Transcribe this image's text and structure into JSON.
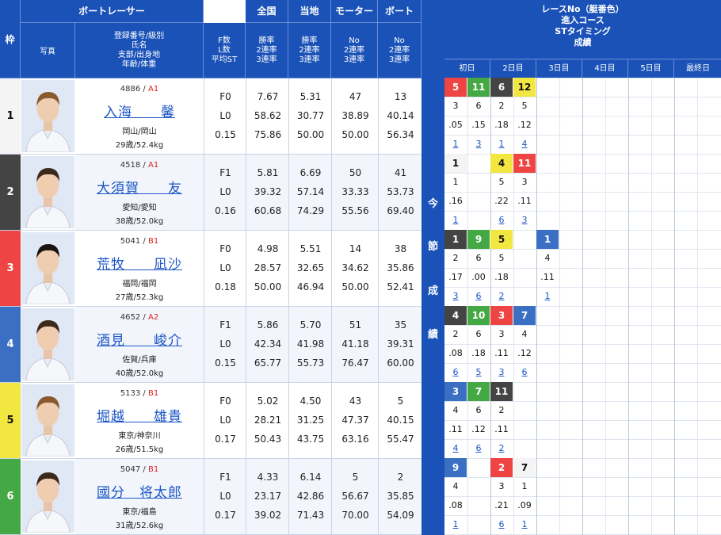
{
  "headers": {
    "waku": "枠",
    "boatracer": "ボートレーサー",
    "photo": "写真",
    "info_lines": [
      "登録番号/級別",
      "氏名",
      "支部/出身地",
      "年齢/体重"
    ],
    "f_lines": [
      "F数",
      "L数",
      "平均ST"
    ],
    "national": "全国",
    "local": "当地",
    "motor": "モーター",
    "boat": "ボート",
    "rate_lines": [
      "勝率",
      "2連率",
      "3連率"
    ],
    "no_lines": [
      "No",
      "2連率",
      "3連率"
    ]
  },
  "right_header": [
    "レースNo（艇番色）",
    "進入コース",
    "STタイミング",
    "成績"
  ],
  "days": [
    "初日",
    "2日目",
    "3日目",
    "4日目",
    "5日目",
    "最終日"
  ],
  "middle_label": [
    "今",
    "節",
    "成",
    "績"
  ],
  "colors": {
    "1": "#f4f4f4",
    "2": "#444444",
    "3": "#ee4444",
    "4": "#3a6fc4",
    "5": "#f2e640",
    "6": "#44a844"
  },
  "racers": [
    {
      "waku": "1",
      "reg": "4886",
      "cls": "A1",
      "name": "入海　　馨",
      "branch": "岡山/岡山",
      "age": "29歳/52.4kg",
      "f": "F0",
      "l": "L0",
      "st": "0.15",
      "nat": [
        "7.67",
        "58.62",
        "75.86"
      ],
      "loc": [
        "5.31",
        "30.77",
        "50.00"
      ],
      "mot": [
        "47",
        "38.89",
        "50.00"
      ],
      "boat": [
        "13",
        "40.14",
        "56.34"
      ],
      "races": [
        {
          "no": "5",
          "boat": "3",
          "course": "3",
          "st": ".05",
          "res": "1"
        },
        {
          "no": "11",
          "boat": "6",
          "course": "6",
          "st": ".15",
          "res": "3"
        },
        {
          "no": "6",
          "boat": "2",
          "course": "2",
          "st": ".18",
          "res": "1"
        },
        {
          "no": "12",
          "boat": "5",
          "course": "5",
          "st": ".12",
          "res": "4"
        }
      ]
    },
    {
      "waku": "2",
      "reg": "4518",
      "cls": "A1",
      "name": "大須賀　　友",
      "branch": "愛知/愛知",
      "age": "38歳/52.0kg",
      "f": "F1",
      "l": "L0",
      "st": "0.16",
      "nat": [
        "5.81",
        "39.32",
        "60.68"
      ],
      "loc": [
        "6.69",
        "57.14",
        "74.29"
      ],
      "mot": [
        "50",
        "33.33",
        "55.56"
      ],
      "boat": [
        "41",
        "53.73",
        "69.40"
      ],
      "races": [
        {
          "no": "1",
          "boat": "1",
          "course": "1",
          "st": ".16",
          "res": "1"
        },
        {
          "no": "",
          "boat": "",
          "course": "",
          "st": "",
          "res": ""
        },
        {
          "no": "4",
          "boat": "5",
          "course": "5",
          "st": ".22",
          "res": "6"
        },
        {
          "no": "11",
          "boat": "3",
          "course": "3",
          "st": ".11",
          "res": "3"
        }
      ]
    },
    {
      "waku": "3",
      "reg": "5041",
      "cls": "B1",
      "name": "荒牧　　凪沙",
      "branch": "福岡/福岡",
      "age": "27歳/52.3kg",
      "f": "F0",
      "l": "L0",
      "st": "0.18",
      "nat": [
        "4.98",
        "28.57",
        "50.00"
      ],
      "loc": [
        "5.51",
        "32.65",
        "46.94"
      ],
      "mot": [
        "14",
        "34.62",
        "50.00"
      ],
      "boat": [
        "38",
        "35.86",
        "52.41"
      ],
      "races": [
        {
          "no": "1",
          "boat": "2",
          "course": "2",
          "st": ".17",
          "res": "3"
        },
        {
          "no": "9",
          "boat": "6",
          "course": "6",
          "st": ".00",
          "res": "6"
        },
        {
          "no": "5",
          "boat": "5",
          "course": "5",
          "st": ".18",
          "res": "2"
        },
        {
          "no": "",
          "boat": "",
          "course": "",
          "st": "",
          "res": ""
        },
        {
          "no": "1",
          "boat": "4",
          "course": "4",
          "st": ".11",
          "res": "1"
        }
      ]
    },
    {
      "waku": "4",
      "reg": "4652",
      "cls": "A2",
      "name": "酒見　　峻介",
      "branch": "佐賀/兵庫",
      "age": "40歳/52.0kg",
      "f": "F1",
      "l": "L0",
      "st": "0.15",
      "nat": [
        "5.86",
        "42.34",
        "65.77"
      ],
      "loc": [
        "5.70",
        "41.98",
        "55.73"
      ],
      "mot": [
        "51",
        "41.18",
        "76.47"
      ],
      "boat": [
        "35",
        "39.31",
        "60.00"
      ],
      "races": [
        {
          "no": "4",
          "boat": "2",
          "course": "2",
          "st": ".08",
          "res": "6"
        },
        {
          "no": "10",
          "boat": "6",
          "course": "6",
          "st": ".18",
          "res": "5"
        },
        {
          "no": "3",
          "boat": "3",
          "course": "3",
          "st": ".11",
          "res": "3"
        },
        {
          "no": "7",
          "boat": "4",
          "course": "4",
          "st": ".12",
          "res": "6"
        }
      ]
    },
    {
      "waku": "5",
      "reg": "5133",
      "cls": "B1",
      "name": "堀越　　雄貴",
      "branch": "東京/神奈川",
      "age": "26歳/51.5kg",
      "f": "F0",
      "l": "L0",
      "st": "0.17",
      "nat": [
        "5.02",
        "28.21",
        "50.43"
      ],
      "loc": [
        "4.50",
        "31.25",
        "43.75"
      ],
      "mot": [
        "43",
        "47.37",
        "63.16"
      ],
      "boat": [
        "5",
        "40.15",
        "55.47"
      ],
      "races": [
        {
          "no": "3",
          "boat": "4",
          "course": "4",
          "st": ".11",
          "res": "4"
        },
        {
          "no": "7",
          "boat": "6",
          "course": "6",
          "st": ".12",
          "res": "6"
        },
        {
          "no": "11",
          "boat": "2",
          "course": "2",
          "st": ".11",
          "res": "2"
        }
      ]
    },
    {
      "waku": "6",
      "reg": "5047",
      "cls": "B1",
      "name": "國分　将太郎",
      "branch": "東京/福島",
      "age": "31歳/52.6kg",
      "f": "F1",
      "l": "L0",
      "st": "0.17",
      "nat": [
        "4.33",
        "23.17",
        "39.02"
      ],
      "loc": [
        "6.14",
        "42.86",
        "71.43"
      ],
      "mot": [
        "5",
        "56.67",
        "70.00"
      ],
      "boat": [
        "2",
        "35.85",
        "54.09"
      ],
      "races": [
        {
          "no": "9",
          "boat": "4",
          "course": "4",
          "st": ".08",
          "res": "1"
        },
        {
          "no": "",
          "boat": "",
          "course": "",
          "st": "",
          "res": ""
        },
        {
          "no": "2",
          "boat": "3",
          "course": "3",
          "st": ".21",
          "res": "6"
        },
        {
          "no": "7",
          "boat": "1",
          "course": "1",
          "st": ".09",
          "res": "1"
        }
      ]
    }
  ]
}
